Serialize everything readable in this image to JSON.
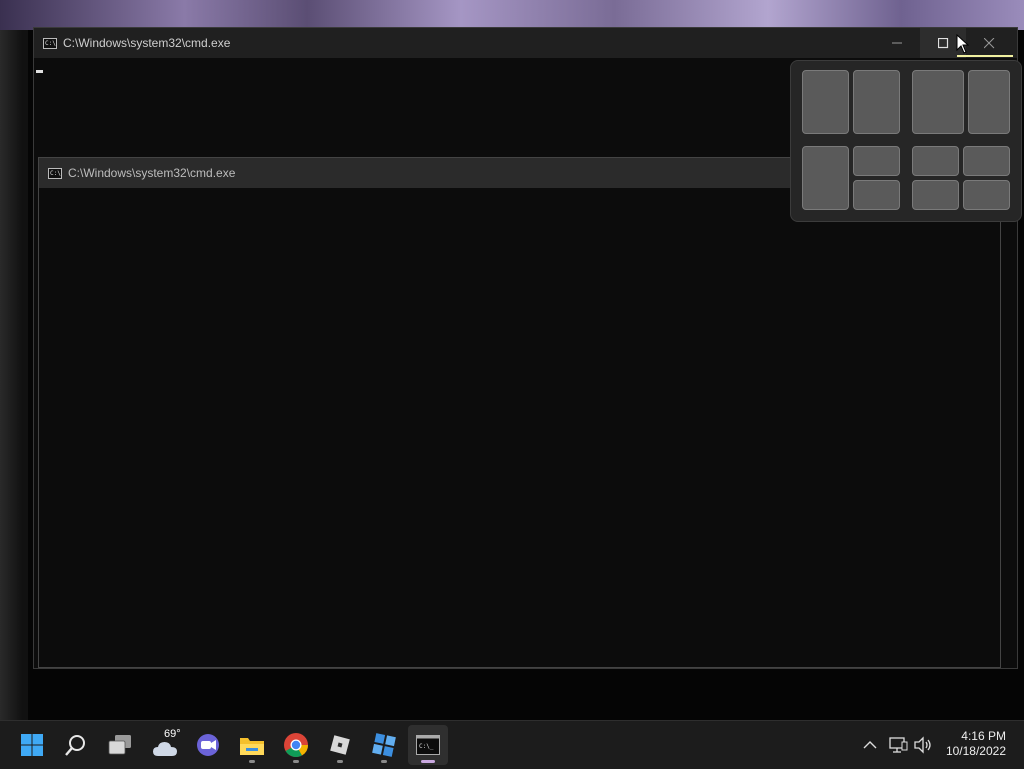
{
  "back_window": {
    "title": "C:\\Windows\\system32\\cmd.exe",
    "icon": "cmd-icon",
    "controls": {
      "minimize": "minimize-icon",
      "maximize": "maximize-icon",
      "close": "close-icon"
    }
  },
  "front_window": {
    "title": "C:\\Windows\\system32\\cmd.exe",
    "icon": "cmd-icon"
  },
  "snap_layouts": {
    "layouts": [
      "two-columns-equal",
      "two-columns-wide-left",
      "one-large-two-stacked",
      "four-quadrants"
    ]
  },
  "taskbar": {
    "weather_temp": "69°",
    "apps": [
      "start",
      "search",
      "task-view",
      "weather",
      "chat",
      "file-explorer",
      "chrome",
      "roblox",
      "roblox-studio",
      "command-prompt"
    ],
    "clock": {
      "time": "4:16 PM",
      "date": "10/18/2022"
    }
  },
  "colors": {
    "accent": "#0078d4",
    "window_bg": "#0c0c0c",
    "taskbar_bg": "#1c1c1c",
    "active_indicator": "#c9a8e0"
  }
}
